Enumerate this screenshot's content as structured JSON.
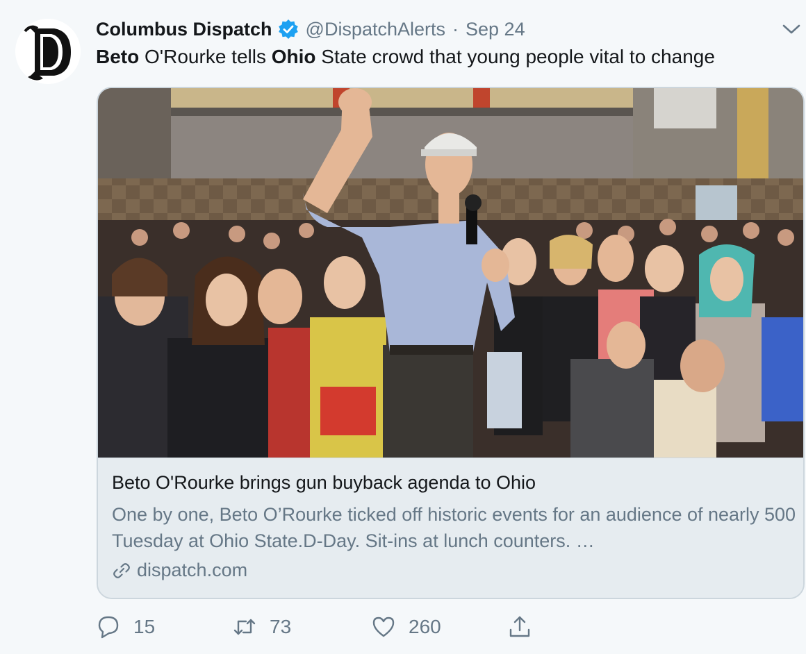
{
  "tweet": {
    "display_name": "Columbus Dispatch",
    "handle": "@DispatchAlerts",
    "separator": "·",
    "date": "Sep 24",
    "text_parts": [
      {
        "text": "Beto",
        "bold": true
      },
      {
        "text": " O'Rourke tells ",
        "bold": false
      },
      {
        "text": "Ohio",
        "bold": true
      },
      {
        "text": " State crowd that young people vital to change",
        "bold": false
      }
    ],
    "avatar_icon": "dispatch-d-logo",
    "verified_icon": "verified-badge-icon",
    "menu_icon": "chevron-down-icon"
  },
  "card": {
    "image_icon": "rally-photo",
    "title": "Beto O'Rourke brings gun buyback agenda to Ohio",
    "description": "One by one, Beto O’Rourke ticked off historic events for an audience of nearly 500 Tuesday at Ohio State.D-Day. Sit-ins at lunch counters. …",
    "domain": "dispatch.com",
    "link_icon": "link-icon"
  },
  "actions": {
    "reply_count": "15",
    "retweet_count": "73",
    "like_count": "260",
    "reply_icon": "reply-icon",
    "retweet_icon": "retweet-icon",
    "like_icon": "heart-icon",
    "share_icon": "share-icon"
  },
  "colors": {
    "background": "#f5f8fa",
    "verified_blue": "#1da1f2",
    "secondary_text": "#657786",
    "border": "#ccd6dd"
  }
}
